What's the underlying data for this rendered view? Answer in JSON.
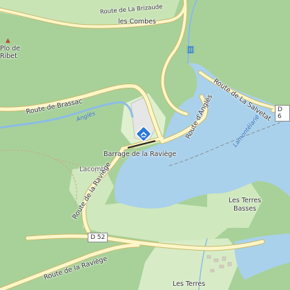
{
  "map": {
    "colors": {
      "forest": "#a8d19a",
      "meadow": "#dff0cf",
      "water": "#a9d1ec",
      "road": "#fdf6c9",
      "road_casing": "#c9b869",
      "river": "#8cbce4",
      "dam_poi": "#2b78d6"
    },
    "labels": {
      "route_brizaude": "Route de La Brizaude",
      "les_combes": "les Combes",
      "peak_name": "Plo de\nRibet",
      "route_brassac": "Route de Brassac",
      "angles_river": "Anglès",
      "route_salvetat": "Route de La Salvetat",
      "d6_partial": "D 6",
      "route_angles": "Route d'Anglès",
      "lamontelarie": "Lamontélarié",
      "barrage": "Barrage de la Raviège",
      "lacombe": "Lacombe",
      "route_raviege_upper": "Route de la Raviège",
      "les_terres_basses": "Les Terres\nBasses",
      "d52": "D 52",
      "route_raviege_lower": "Route de la Raviège",
      "les_terres": "Les Terres"
    },
    "icons": {
      "peak": "triangle-peak-icon",
      "dam_poi": "dam-poi-icon",
      "water_tower": "water-structure-icon"
    }
  }
}
